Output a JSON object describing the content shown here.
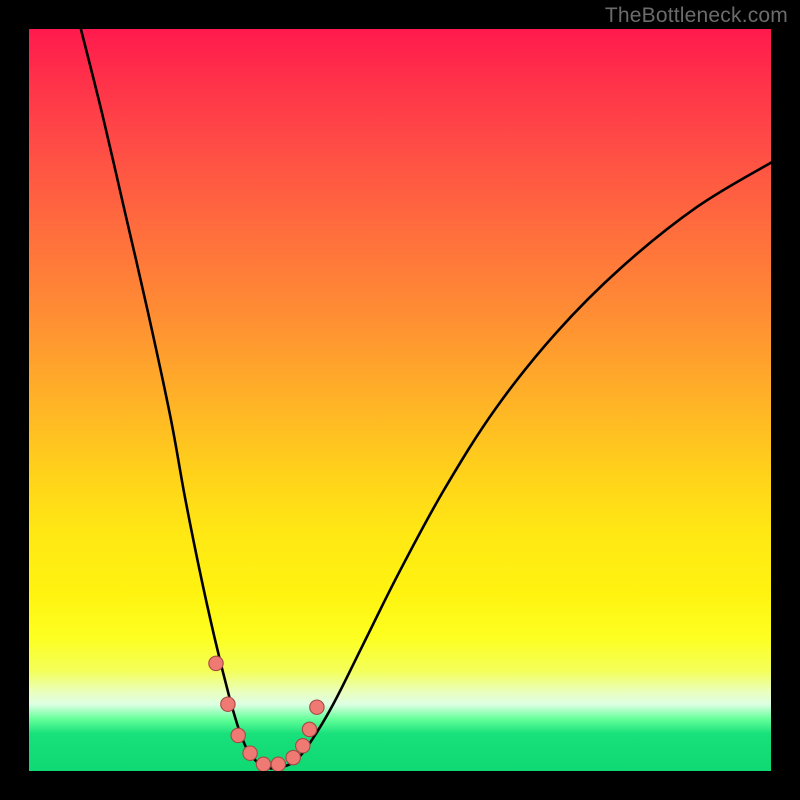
{
  "watermark": "TheBottleneck.com",
  "colors": {
    "frame": "#000000",
    "gradient_top": "#ff1a4d",
    "gradient_mid": "#ffe814",
    "gradient_bottom": "#0fd973",
    "curve": "#000000",
    "dot_fill": "#ef7a73",
    "dot_stroke": "#a54a44"
  },
  "chart_data": {
    "type": "line",
    "title": "",
    "xlabel": "",
    "ylabel": "",
    "xlim": [
      0,
      100
    ],
    "ylim": [
      0,
      100
    ],
    "note": "V-shaped bottleneck curve; y≈0 near x≈28–36, rising steeply on both sides. Values estimated from pixels.",
    "series": [
      {
        "name": "bottleneck-curve",
        "x": [
          7,
          10,
          13,
          16,
          19,
          21,
          23,
          25,
          27,
          28.5,
          30,
          32,
          34,
          36,
          38,
          41,
          45,
          50,
          56,
          63,
          71,
          80,
          90,
          100
        ],
        "y": [
          100,
          88,
          75,
          62,
          48,
          37,
          27,
          18,
          10,
          5,
          2,
          0.5,
          0.5,
          1.5,
          4,
          9,
          17,
          27,
          38,
          49,
          59,
          68,
          76,
          82
        ]
      }
    ],
    "markers": {
      "name": "highlight-dots",
      "x": [
        25.2,
        26.8,
        28.2,
        29.8,
        31.6,
        33.6,
        35.6,
        36.9,
        37.8,
        38.8
      ],
      "y": [
        14.5,
        9.0,
        4.8,
        2.4,
        0.9,
        0.9,
        1.8,
        3.4,
        5.6,
        8.6
      ]
    }
  }
}
